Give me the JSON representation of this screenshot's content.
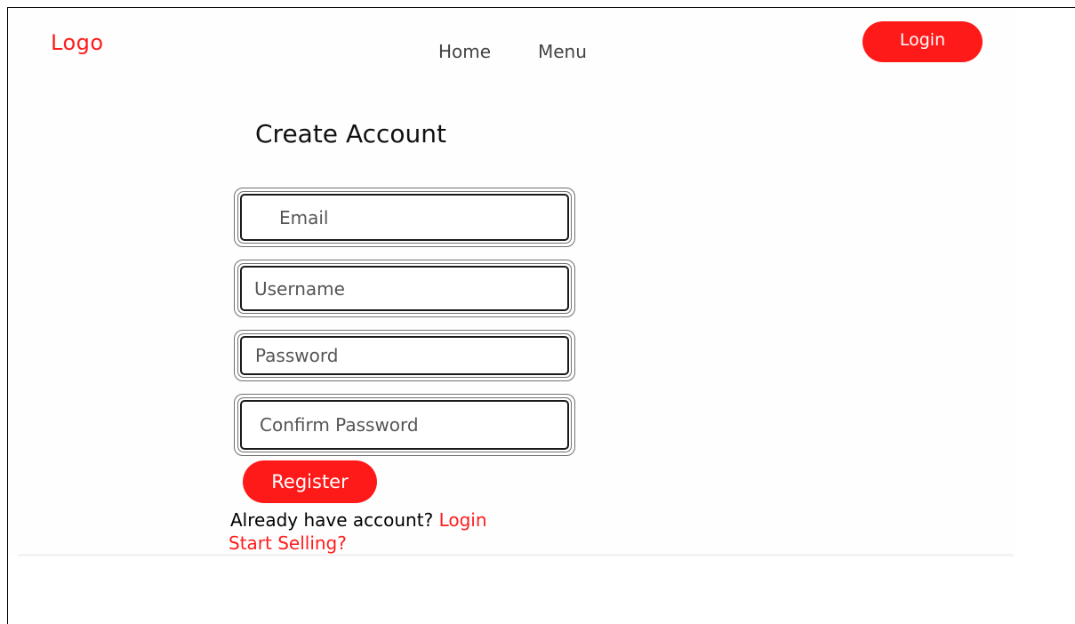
{
  "header": {
    "logo": "Logo",
    "nav": [
      {
        "label": "Home"
      },
      {
        "label": "Menu"
      }
    ],
    "login_label": "Login"
  },
  "form": {
    "title": "Create Account",
    "fields": [
      {
        "placeholder": "Email",
        "value": ""
      },
      {
        "placeholder": "Username",
        "value": ""
      },
      {
        "placeholder": "Password",
        "value": ""
      },
      {
        "placeholder": "Confirm Password",
        "value": ""
      }
    ],
    "register_label": "Register",
    "have_account_text": "Already have account?",
    "login_link_label": "Login",
    "start_selling_label": "Start Selling?"
  },
  "colors": {
    "accent": "#ff1a1a",
    "text": "#111111",
    "nav_text": "#444444"
  }
}
